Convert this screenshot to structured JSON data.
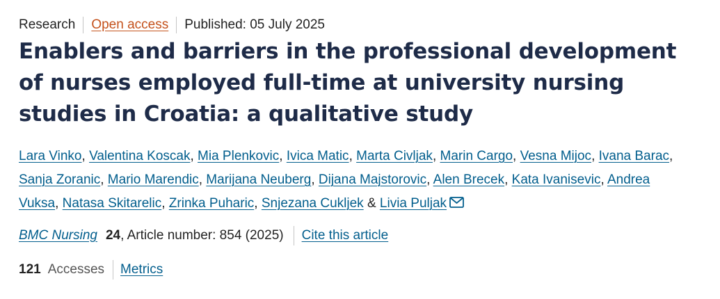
{
  "meta": {
    "type": "Research",
    "access": "Open access",
    "published": "Published: 05 July 2025"
  },
  "title": "Enablers and barriers in the professional development of nurses employed full-time at university nursing studies in Croatia: a qualitative study",
  "authors": [
    "Lara Vinko",
    "Valentina Koscak",
    "Mia Plenkovic",
    "Ivica Matic",
    "Marta Civljak",
    "Marin Cargo",
    "Vesna Mijoc",
    "Ivana Barac",
    "Sanja Zoranic",
    "Mario Marendic",
    "Marijana Neuberg",
    "Dijana Majstorovic",
    "Alen Brecek",
    "Kata Ivanisevic",
    "Andrea Vuksa",
    "Natasa Skitarelic",
    "Zrinka Puharic",
    "Snjezana Cukljek"
  ],
  "last_author": "Livia Puljak",
  "author_joiner": "&",
  "journal": {
    "name": "BMC Nursing",
    "volume": "24",
    "article_info": ", Article number: 854 (2025)",
    "cite_label": "Cite this article"
  },
  "metrics": {
    "count": "121",
    "label": "Accesses",
    "link_label": "Metrics"
  },
  "icons": {
    "contact": "mail-icon"
  },
  "colors": {
    "link": "#025e8d",
    "open_access": "#c4511b",
    "title": "#1e2b48"
  }
}
